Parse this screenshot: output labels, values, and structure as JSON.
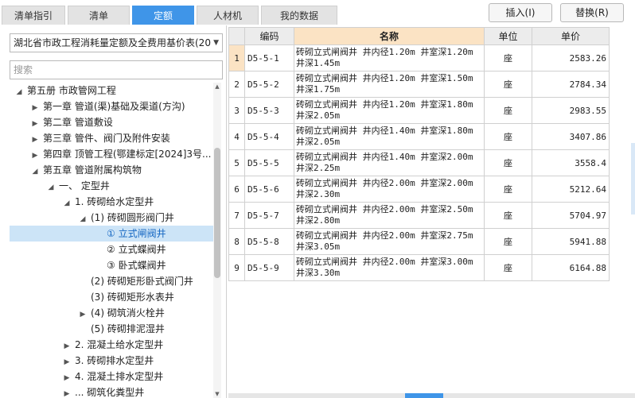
{
  "tabs": [
    "清单指引",
    "清单",
    "定额",
    "人材机",
    "我的数据"
  ],
  "active_tab": 2,
  "buttons": {
    "insert": "插入(I)",
    "replace": "替换(R)"
  },
  "dropdown": {
    "value": "湖北省市政工程消耗量定额及全费用基价表(20"
  },
  "search": {
    "placeholder": "搜索"
  },
  "tree": [
    {
      "label": "第五册 市政管网工程",
      "toggle": "expanded",
      "level": 0
    },
    {
      "label": "第一章 管道(渠)基础及渠道(方沟)",
      "toggle": "collapsed",
      "level": 1
    },
    {
      "label": "第二章 管道敷设",
      "toggle": "collapsed",
      "level": 1
    },
    {
      "label": "第三章 管件、阀门及附件安装",
      "toggle": "collapsed",
      "level": 1
    },
    {
      "label": "第四章 顶管工程(鄂建标定[2024]3号...",
      "toggle": "collapsed",
      "level": 1
    },
    {
      "label": "第五章 管道附属构筑物",
      "toggle": "expanded",
      "level": 1
    },
    {
      "label": "一、 定型井",
      "toggle": "expanded",
      "level": 2
    },
    {
      "label": "1. 砖砌给水定型井",
      "toggle": "expanded",
      "level": 3
    },
    {
      "label": "(1) 砖砌圆形阀门井",
      "toggle": "expanded",
      "level": 4
    },
    {
      "label": "① 立式闸阀井",
      "toggle": "none",
      "level": 5,
      "selected": true
    },
    {
      "label": "② 立式蝶阀井",
      "toggle": "none",
      "level": 5
    },
    {
      "label": "③ 卧式蝶阀井",
      "toggle": "none",
      "level": 5
    },
    {
      "label": "(2) 砖砌矩形卧式阀门井",
      "toggle": "none",
      "level": 4
    },
    {
      "label": "(3) 砖砌矩形水表井",
      "toggle": "none",
      "level": 4
    },
    {
      "label": "(4) 砌筑消火栓井",
      "toggle": "collapsed",
      "level": 4
    },
    {
      "label": "(5) 砖砌排泥湿井",
      "toggle": "none",
      "level": 4
    },
    {
      "label": "2. 混凝土给水定型井",
      "toggle": "collapsed",
      "level": 3
    },
    {
      "label": "3. 砖砌排水定型井",
      "toggle": "collapsed",
      "level": 3
    },
    {
      "label": "4. 混凝土排水定型井",
      "toggle": "collapsed",
      "level": 3
    },
    {
      "label": "... 砌筑化粪型井",
      "toggle": "collapsed",
      "level": 3
    }
  ],
  "grid": {
    "headers": [
      "编码",
      "名称",
      "单位",
      "单价"
    ],
    "highlight_header": 1,
    "rows": [
      {
        "idx": "1",
        "code": "D5-5-1",
        "name": "砖砌立式闸阀井 井内径1.20m 井室深1.20m 井深1.45m",
        "unit": "座",
        "price": "2583.26",
        "selected": true
      },
      {
        "idx": "2",
        "code": "D5-5-2",
        "name": "砖砌立式闸阀井 井内径1.20m 井室深1.50m 井深1.75m",
        "unit": "座",
        "price": "2784.34"
      },
      {
        "idx": "3",
        "code": "D5-5-3",
        "name": "砖砌立式闸阀井 井内径1.20m 井室深1.80m 井深2.05m",
        "unit": "座",
        "price": "2983.55"
      },
      {
        "idx": "4",
        "code": "D5-5-4",
        "name": "砖砌立式闸阀井 井内径1.40m 井室深1.80m 井深2.05m",
        "unit": "座",
        "price": "3407.86"
      },
      {
        "idx": "5",
        "code": "D5-5-5",
        "name": "砖砌立式闸阀井 井内径1.40m 井室深2.00m 井深2.25m",
        "unit": "座",
        "price": "3558.4"
      },
      {
        "idx": "6",
        "code": "D5-5-6",
        "name": "砖砌立式闸阀井 井内径2.00m 井室深2.00m 井深2.30m",
        "unit": "座",
        "price": "5212.64"
      },
      {
        "idx": "7",
        "code": "D5-5-7",
        "name": "砖砌立式闸阀井 井内径2.00m 井室深2.50m 井深2.80m",
        "unit": "座",
        "price": "5704.97"
      },
      {
        "idx": "8",
        "code": "D5-5-8",
        "name": "砖砌立式闸阀井 井内径2.00m 井室深2.75m 井深3.05m",
        "unit": "座",
        "price": "5941.88"
      },
      {
        "idx": "9",
        "code": "D5-5-9",
        "name": "砖砌立式闸阀井 井内径2.00m 井室深3.00m 井深3.30m",
        "unit": "座",
        "price": "6164.88"
      }
    ]
  },
  "colors": {
    "accent": "#3f95e8",
    "selection": "#cce4f7",
    "header_highlight": "#fbe3c4"
  }
}
